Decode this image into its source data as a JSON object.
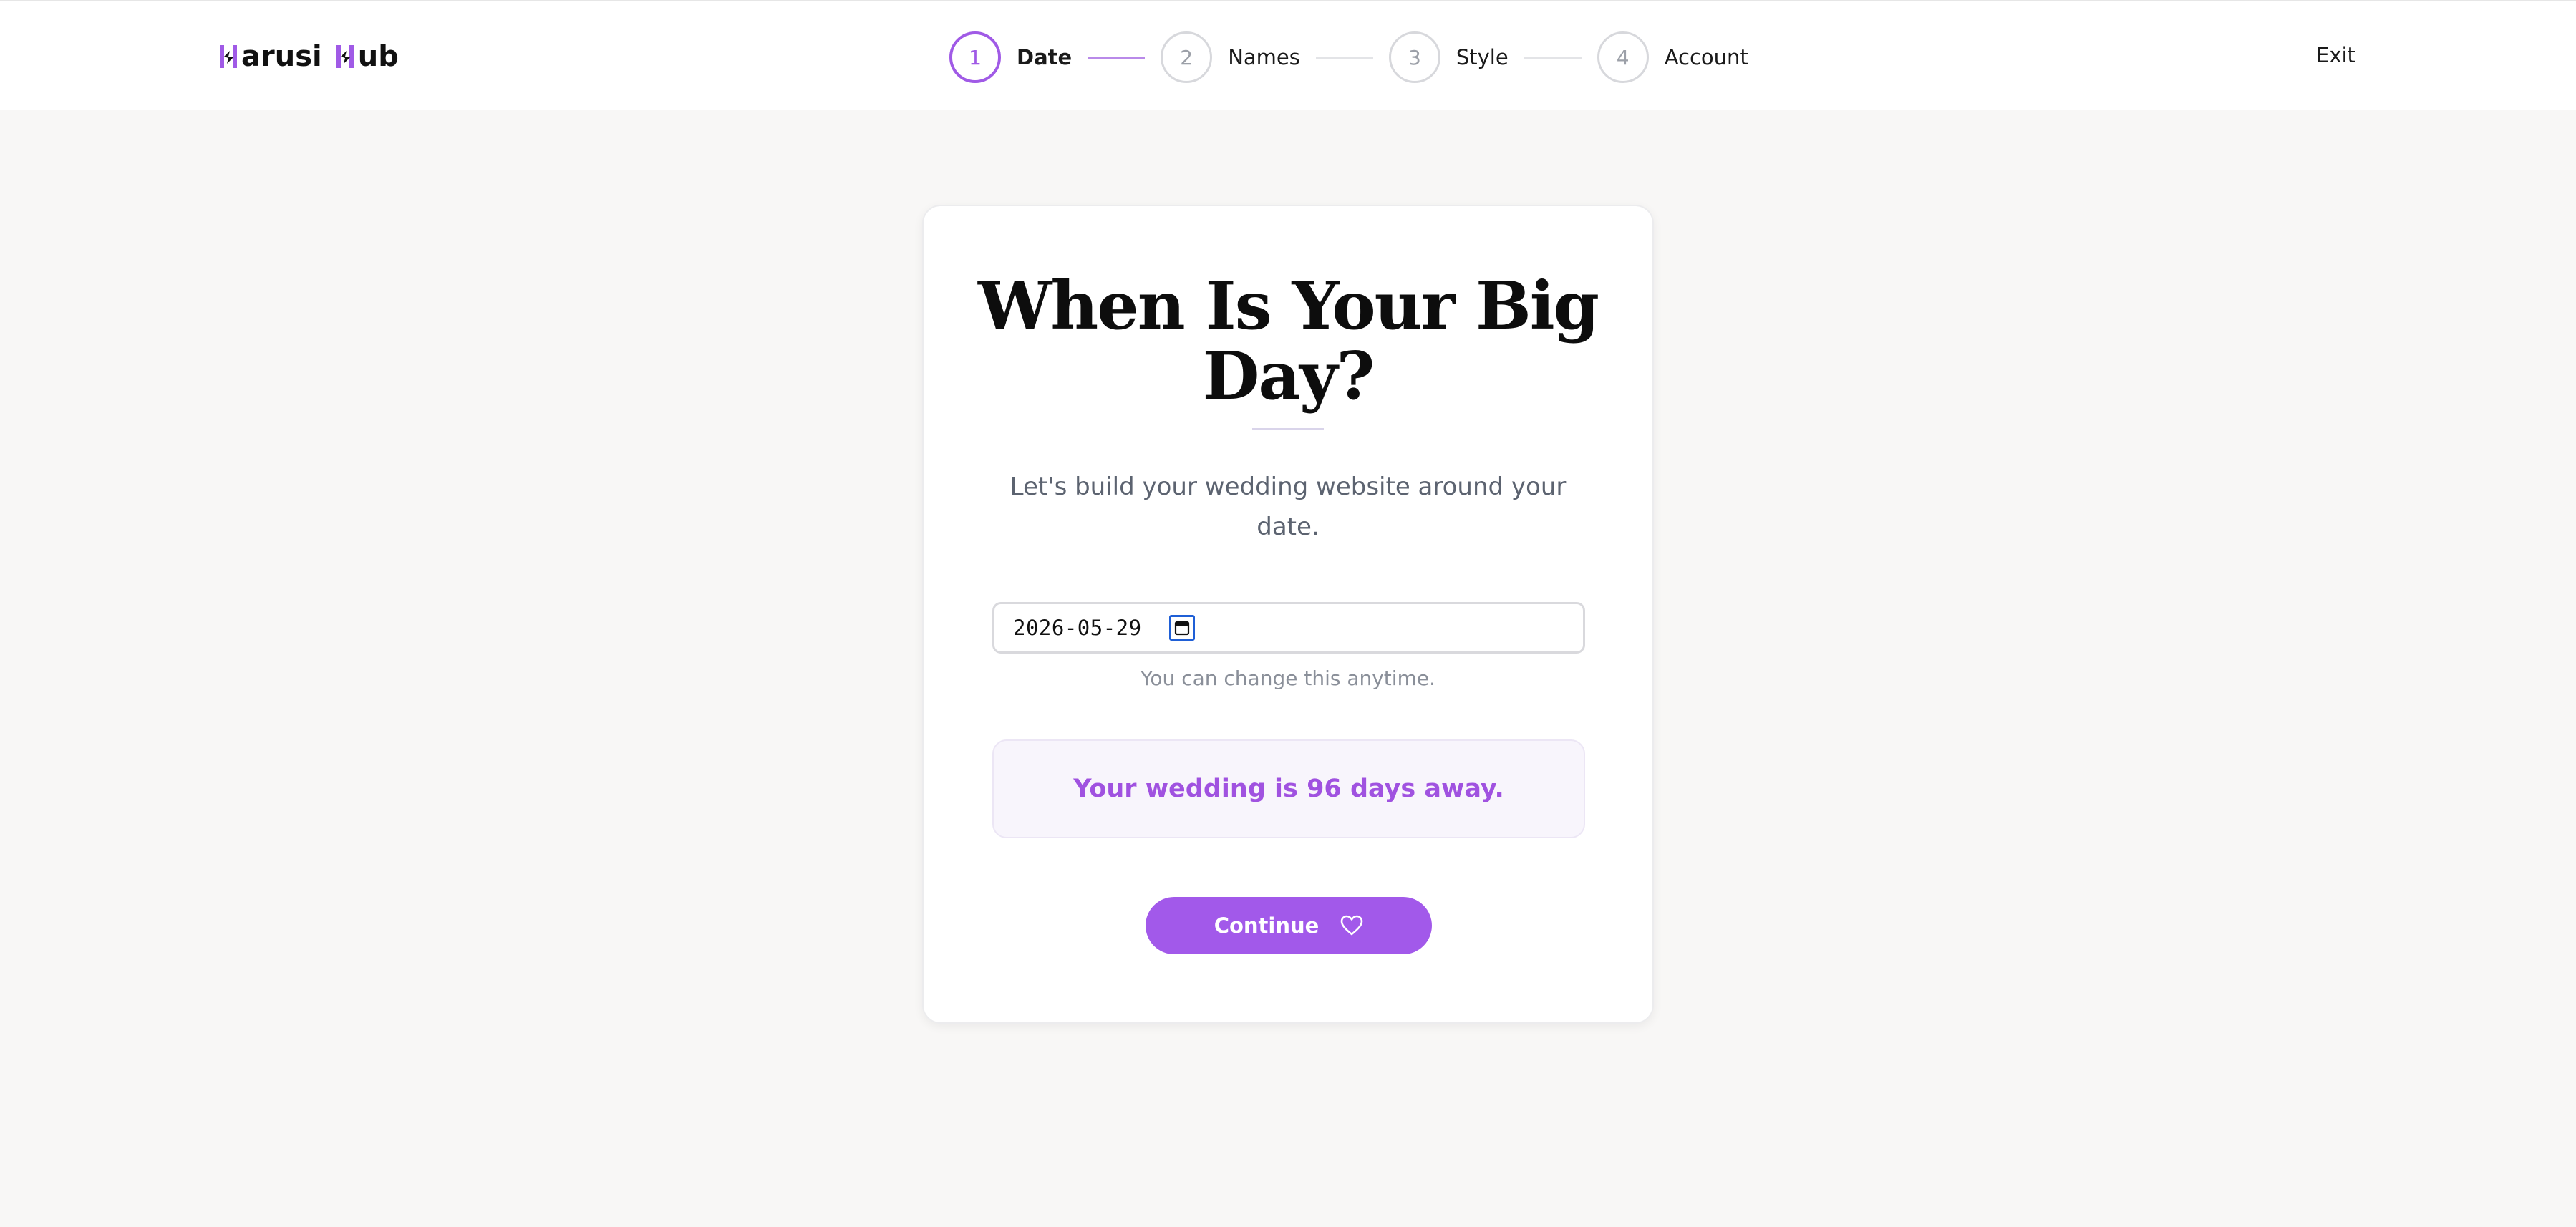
{
  "header": {
    "logo_word1": "arusi",
    "logo_word2": "ub",
    "exit_label": "Exit"
  },
  "stepper": {
    "steps": [
      {
        "number": "1",
        "label": "Date",
        "active": true
      },
      {
        "number": "2",
        "label": "Names",
        "active": false
      },
      {
        "number": "3",
        "label": "Style",
        "active": false
      },
      {
        "number": "4",
        "label": "Account",
        "active": false
      }
    ]
  },
  "card": {
    "title": "When Is Your Big Day?",
    "subtitle": "Let's build your wedding website around your date.",
    "date_value": "2026-05-29",
    "hint": "You can change this anytime.",
    "countdown": "Your wedding is 96 days away.",
    "continue_label": "Continue"
  },
  "icons": {
    "calendar": "calendar-icon",
    "heart": "heart-icon",
    "logo": "logo-mark-icon"
  },
  "colors": {
    "accent": "#a259ea",
    "accent_text": "#a052e0",
    "page_bg": "#f8f7f6",
    "focus_ring": "#1f5fd6"
  }
}
